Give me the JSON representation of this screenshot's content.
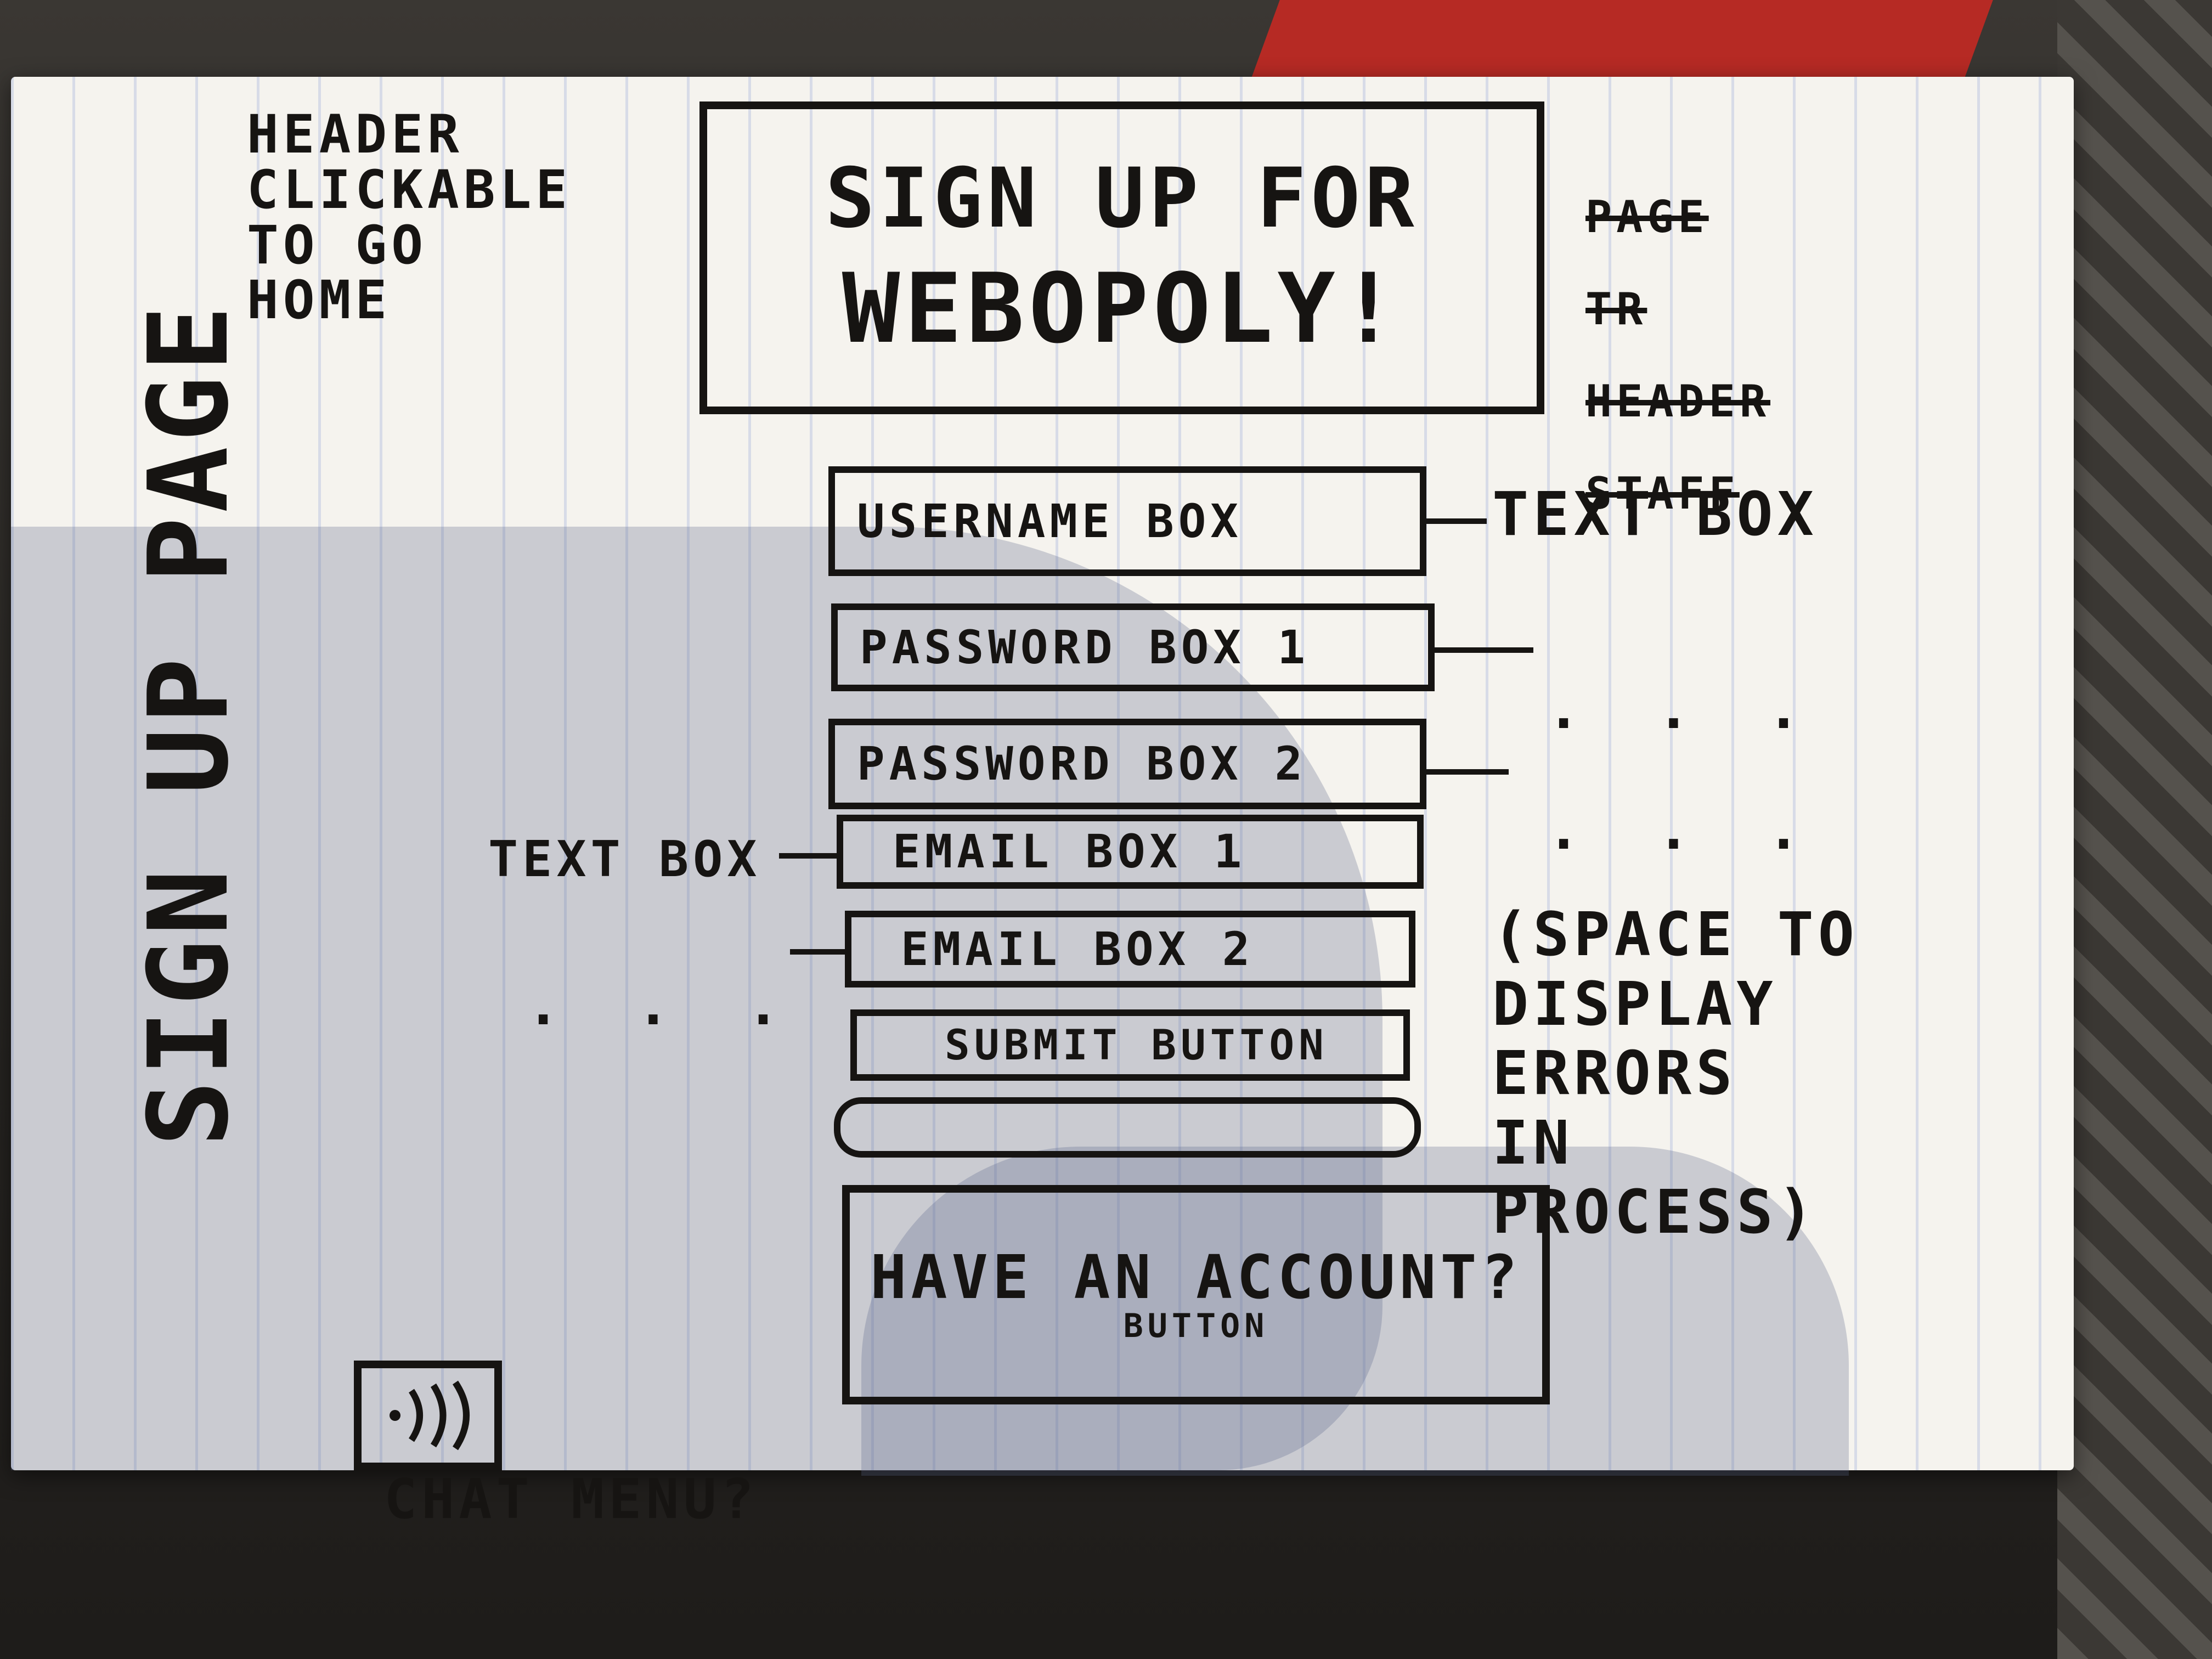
{
  "header": {
    "title_line1": "SIGN UP FOR",
    "title_line2": "WEBOPOLY!",
    "note": "HEADER\nCLICKABLE\nTO GO\nHOME",
    "struck_note": [
      "PAGE",
      "TR",
      "HEADER",
      "STAFF"
    ]
  },
  "form": {
    "username_label": "USERNAME BOX",
    "password1_label": "PASSWORD BOX 1",
    "password2_label": "PASSWORD BOX 2",
    "email1_label": "EMAIL BOX 1",
    "email2_label": "EMAIL BOX 2",
    "submit_label": "SUBMIT BUTTON",
    "have_account_label": "HAVE AN ACCOUNT?",
    "have_account_sublabel": "BUTTON"
  },
  "notes": {
    "text_box_right": "TEXT BOX",
    "ellipsis": ". . .",
    "text_box_left": "TEXT BOX",
    "errors": "(SPACE TO\nDISPLAY\nERRORS\nIN\nPROCESS)",
    "page_label": "SIGN UP PAGE",
    "chat_menu": "CHAT MENU?"
  },
  "icons": {
    "chat": "chat-wave-icon"
  }
}
